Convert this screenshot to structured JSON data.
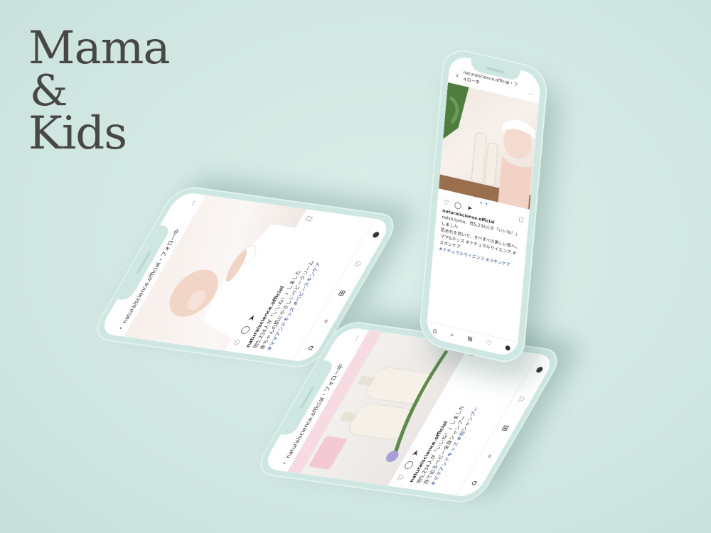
{
  "brand": {
    "line1": "Mama",
    "amp": "&",
    "line2": "Kids"
  },
  "phones": {
    "upright": {
      "account": "naturalscience.official・フォロー中",
      "user": "naturalscience.official",
      "caption1": "nelsh.tomo、他5,234人が「いいね！」しました",
      "caption2": "肌あれを防いで、すべすべの美しい肌へ。",
      "caption3": "ママ&キッズ #ナチュラルサイエンス #スキンケア",
      "tags": "#ナチュラルサイエンス #スキンケア"
    },
    "baby": {
      "account": "naturalscience.official・フォロー中",
      "user": "naturalscience.official",
      "caption1": "他5,234人が「いいね！」しました",
      "caption2": "赤ちゃんの肌にやさしいベビークリーム",
      "tags": "#ママアンドキッズ #ベビースキンケア"
    },
    "bottles": {
      "account": "naturalscience.official・フォロー中",
      "user": "naturalscience.official",
      "caption1": "他5,234人が「いいね！」しました",
      "caption2": "泡で出るベビー全身シャンプー",
      "tags": "#ママアンドキッズ #泡シャンプー"
    }
  },
  "colors": {
    "background": "#d3e8e3",
    "phone": "#cfe7e2",
    "text": "#474747",
    "link": "#2f4d92"
  }
}
